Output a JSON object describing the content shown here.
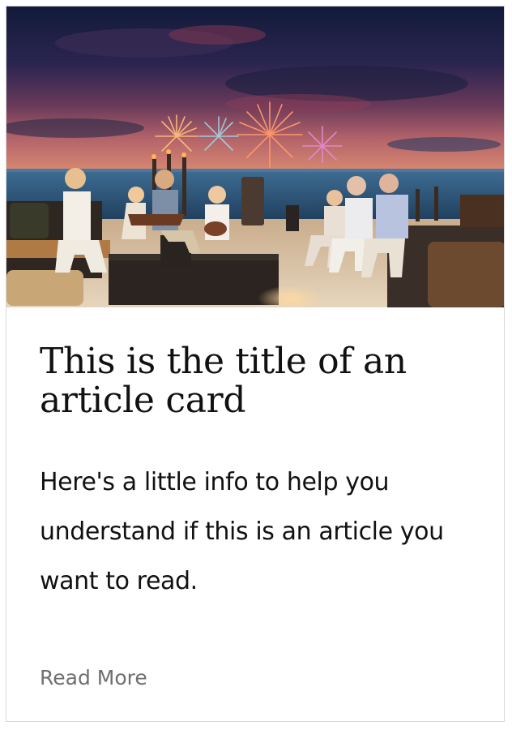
{
  "card": {
    "title": "This is the title of an article card",
    "description": "Here's a little info to help you understand if this is an article you want to read.",
    "link_label": "Read More"
  },
  "colors": {
    "title": "#111111",
    "description": "#111111",
    "link": "#6f6f6f",
    "border": "#d7d7d7"
  }
}
